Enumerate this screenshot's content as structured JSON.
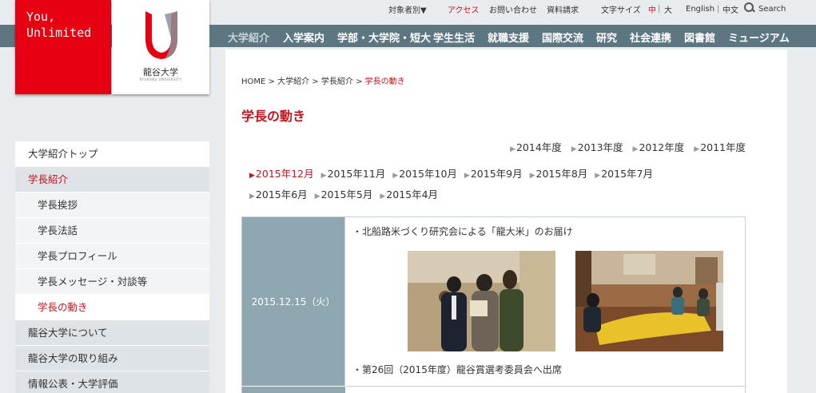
{
  "logo": {
    "tagline": "You,\nUnlimited",
    "university_name": "龍谷大学",
    "university_name_en": "RYUKOKU UNIVERSITY",
    "colors": {
      "red": "#e60012",
      "mark_red": "#e60012",
      "mark_gray": "#8a9499"
    }
  },
  "utility": {
    "audience": "対象者別▼",
    "access": "アクセス",
    "contact": "お問い合わせ",
    "brochure": "資料請求",
    "text_size_label": "文字サイズ",
    "size_medium": "中",
    "size_sep": "|",
    "size_large": "大",
    "english": "English",
    "chinese": "中文",
    "lang_sep": "|",
    "search": "Search"
  },
  "global_nav": [
    "大学紹介",
    "入学案内",
    "学部・大学院・短大",
    "学生生活",
    "就職支援",
    "国際交流",
    "研究",
    "社会連携",
    "図書館",
    "ミュージアム"
  ],
  "sidebar": {
    "items": [
      {
        "label": "大学紹介トップ"
      },
      {
        "label": "学長紹介"
      },
      {
        "label": "学長挨拶"
      },
      {
        "label": "学長法話"
      },
      {
        "label": "学長プロフィール"
      },
      {
        "label": "学長メッセージ・対談等"
      },
      {
        "label": "学長の動き"
      },
      {
        "label": "龍谷大学について"
      },
      {
        "label": "龍谷大学の取り組み"
      },
      {
        "label": "情報公表・大学評価"
      }
    ]
  },
  "breadcrumb": {
    "home": "HOME",
    "sep": ">",
    "about": "大学紹介",
    "president": "学長紹介",
    "current": "学長の動き"
  },
  "page_title": "学長の動き",
  "years": [
    "2014年度",
    "2013年度",
    "2012年度",
    "2011年度"
  ],
  "months": [
    "2015年12月",
    "2015年11月",
    "2015年10月",
    "2015年9月",
    "2015年8月",
    "2015年7月",
    "2015年6月",
    "2015年5月",
    "2015年4月"
  ],
  "arrow_glyph": "▶",
  "news": {
    "date": "2015.12.15（火）",
    "bullet_glyph": "・",
    "item1": "北船路米づくり研究会による「龍大米」のお届け",
    "item2": "第26回（2015年度）龍谷賞選考委員会へ出席"
  },
  "colors": {
    "accent_red": "#c0161f",
    "nav_bg": "#5c7682",
    "date_cell_bg": "#8ea7b1",
    "page_bg": "#e9ecee"
  }
}
